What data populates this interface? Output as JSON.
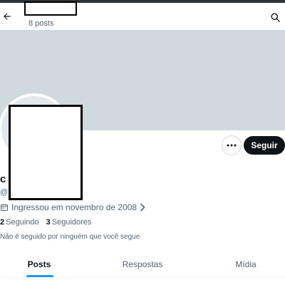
{
  "header": {
    "post_count": "8 posts"
  },
  "icons": {
    "back": "arrow-left-icon",
    "search": "search-icon",
    "more": "more-horizontal-icon",
    "calendar": "calendar-icon",
    "chevron": "chevron-right-icon"
  },
  "profile": {
    "name_fragment": "c",
    "handle_fragment": "@",
    "joined": "Ingressou em novembro de 2008",
    "following_count": "2",
    "following_label": "Seguindo",
    "followers_count": "3",
    "followers_label": "Seguidores",
    "followed_note": "Não é seguido por ninguém que você segue"
  },
  "actions": {
    "follow_label": "Seguir"
  },
  "tabs": [
    {
      "label": "Posts",
      "active": true
    },
    {
      "label": "Respostas",
      "active": false
    },
    {
      "label": "Mídia",
      "active": false
    }
  ],
  "colors": {
    "banner": "#cfd9de",
    "accent": "#1d9bf0",
    "follow_button": "#0f1419",
    "secondary_text": "#536471"
  }
}
